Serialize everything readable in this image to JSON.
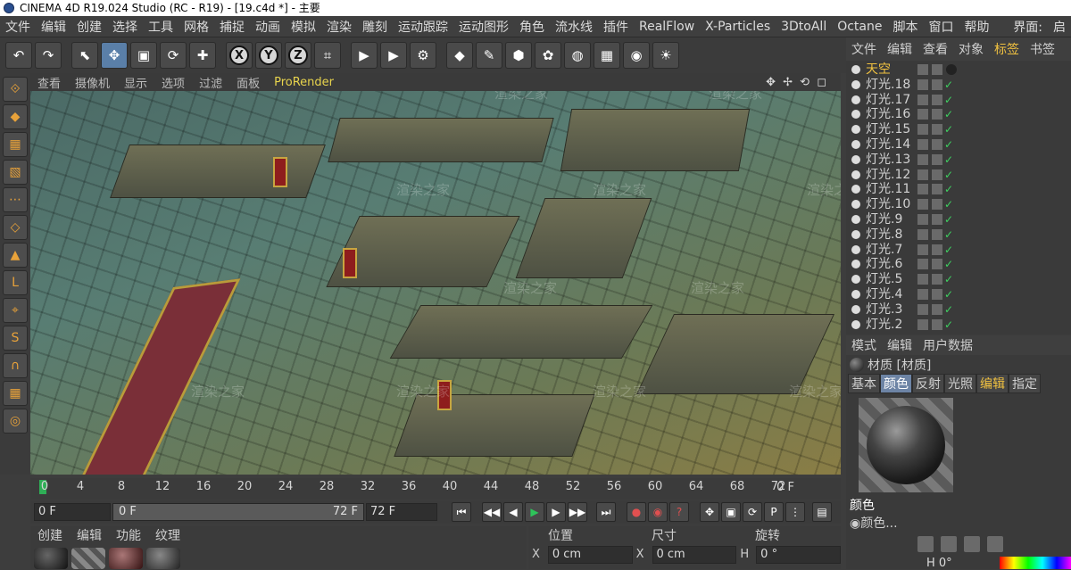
{
  "window": {
    "title": "CINEMA 4D R19.024 Studio (RC - R19) - [19.c4d *] - 主要"
  },
  "menu": {
    "items": [
      "文件",
      "编辑",
      "创建",
      "选择",
      "工具",
      "网格",
      "捕捉",
      "动画",
      "模拟",
      "渲染",
      "雕刻",
      "运动跟踪",
      "运动图形",
      "角色",
      "流水线",
      "插件",
      "RealFlow",
      "X-Particles",
      "3DtoAll",
      "Octane",
      "脚本",
      "窗口",
      "帮助"
    ],
    "layout_label": "界面:",
    "layout_value": "启"
  },
  "toolbar": {
    "icons": [
      "undo-icon",
      "redo-icon",
      "live-select-icon",
      "move-icon",
      "scale-icon",
      "rotate-icon",
      "add-icon",
      "x-axis-icon",
      "y-axis-icon",
      "z-axis-icon",
      "coordinate-system-icon",
      "render-view-icon",
      "render-picture-queue-icon",
      "render-settings-icon",
      "cube-icon",
      "pen-icon",
      "subdivision-icon",
      "cloner-icon",
      "deformer-icon",
      "floor-icon",
      "camera-icon",
      "light-icon"
    ],
    "axis_labels": [
      "X",
      "Y",
      "Z"
    ]
  },
  "left_tools": {
    "icons": [
      "make-editable-icon",
      "model-mode-icon",
      "texture-mode-icon",
      "workplane-icon",
      "points-mode-icon",
      "edges-mode-icon",
      "polygons-mode-icon",
      "axis-mode-icon",
      "tweak-mode-icon",
      "snap-icon",
      "magnet-icon",
      "lock-workplane-icon",
      "solo-icon"
    ]
  },
  "viewport": {
    "menu": [
      "查看",
      "摄像机",
      "显示",
      "选项",
      "过滤",
      "面板",
      "ProRender"
    ],
    "watermark_text": "渲染之家",
    "watermark_sub": "51RENDER.COM"
  },
  "timeline": {
    "ticks": [
      "0",
      "4",
      "8",
      "12",
      "16",
      "20",
      "24",
      "28",
      "32",
      "36",
      "40",
      "44",
      "48",
      "52",
      "56",
      "60",
      "64",
      "68",
      "72"
    ],
    "current_frame": "0",
    "end_label": "0 F"
  },
  "transport": {
    "start_field": "0 F",
    "range_min": "0 F",
    "range_max": "72 F",
    "end_field": "72 F"
  },
  "material_manager": {
    "tabs": [
      "创建",
      "编辑",
      "功能",
      "纹理"
    ]
  },
  "coordinates": {
    "headers": [
      "位置",
      "尺寸",
      "旋转"
    ],
    "x_pos": "0 cm",
    "x_size": "0 cm",
    "h_rot": "0 °",
    "labels": [
      "X",
      "X",
      "H"
    ]
  },
  "object_manager": {
    "tabs": [
      "文件",
      "编辑",
      "查看",
      "对象",
      "标签",
      "书签"
    ],
    "objects": [
      "天空",
      "灯光.18",
      "灯光.17",
      "灯光.16",
      "灯光.15",
      "灯光.14",
      "灯光.13",
      "灯光.12",
      "灯光.11",
      "灯光.10",
      "灯光.9",
      "灯光.8",
      "灯光.7",
      "灯光.6",
      "灯光.5",
      "灯光.4",
      "灯光.3",
      "灯光.2"
    ]
  },
  "attribute_manager": {
    "tabs": [
      "模式",
      "编辑",
      "用户数据"
    ],
    "material_title": "材质 [材质]",
    "channel_tabs": [
      "基本",
      "颜色",
      "反射",
      "光照",
      "编辑",
      "指定"
    ],
    "selected_tab": "颜色",
    "section": "颜色",
    "color_row": "◉颜色...",
    "h_value": "H 0°"
  }
}
